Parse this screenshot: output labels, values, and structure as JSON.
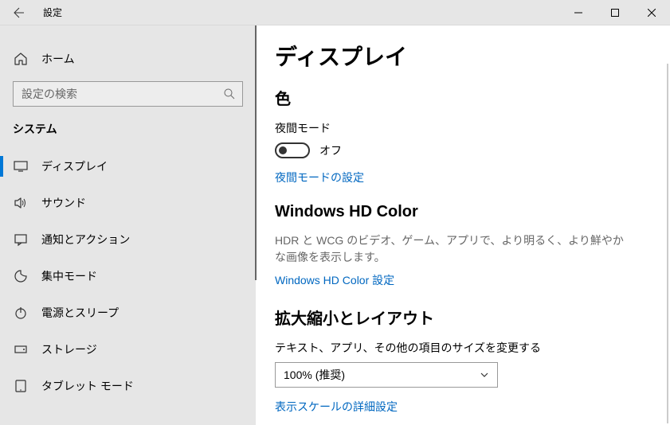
{
  "window": {
    "title": "設定"
  },
  "sidebar": {
    "home": "ホーム",
    "search_placeholder": "設定の検索",
    "category": "システム",
    "items": [
      {
        "label": "ディスプレイ",
        "icon": "display"
      },
      {
        "label": "サウンド",
        "icon": "sound"
      },
      {
        "label": "通知とアクション",
        "icon": "notifications"
      },
      {
        "label": "集中モード",
        "icon": "focus"
      },
      {
        "label": "電源とスリープ",
        "icon": "power"
      },
      {
        "label": "ストレージ",
        "icon": "storage"
      },
      {
        "label": "タブレット モード",
        "icon": "tablet"
      }
    ]
  },
  "content": {
    "page_title": "ディスプレイ",
    "color_heading": "色",
    "night_light_label": "夜間モード",
    "night_light_state": "オフ",
    "night_light_settings_link": "夜間モードの設定",
    "hd_color_heading": "Windows HD Color",
    "hd_color_desc": "HDR と WCG のビデオ、ゲーム、アプリで、より明るく、より鮮やかな画像を表示します。",
    "hd_color_link": "Windows HD Color 設定",
    "scale_heading": "拡大縮小とレイアウト",
    "scale_label": "テキスト、アプリ、その他の項目のサイズを変更する",
    "scale_value": "100% (推奨)",
    "scale_advanced_link": "表示スケールの詳細設定"
  }
}
